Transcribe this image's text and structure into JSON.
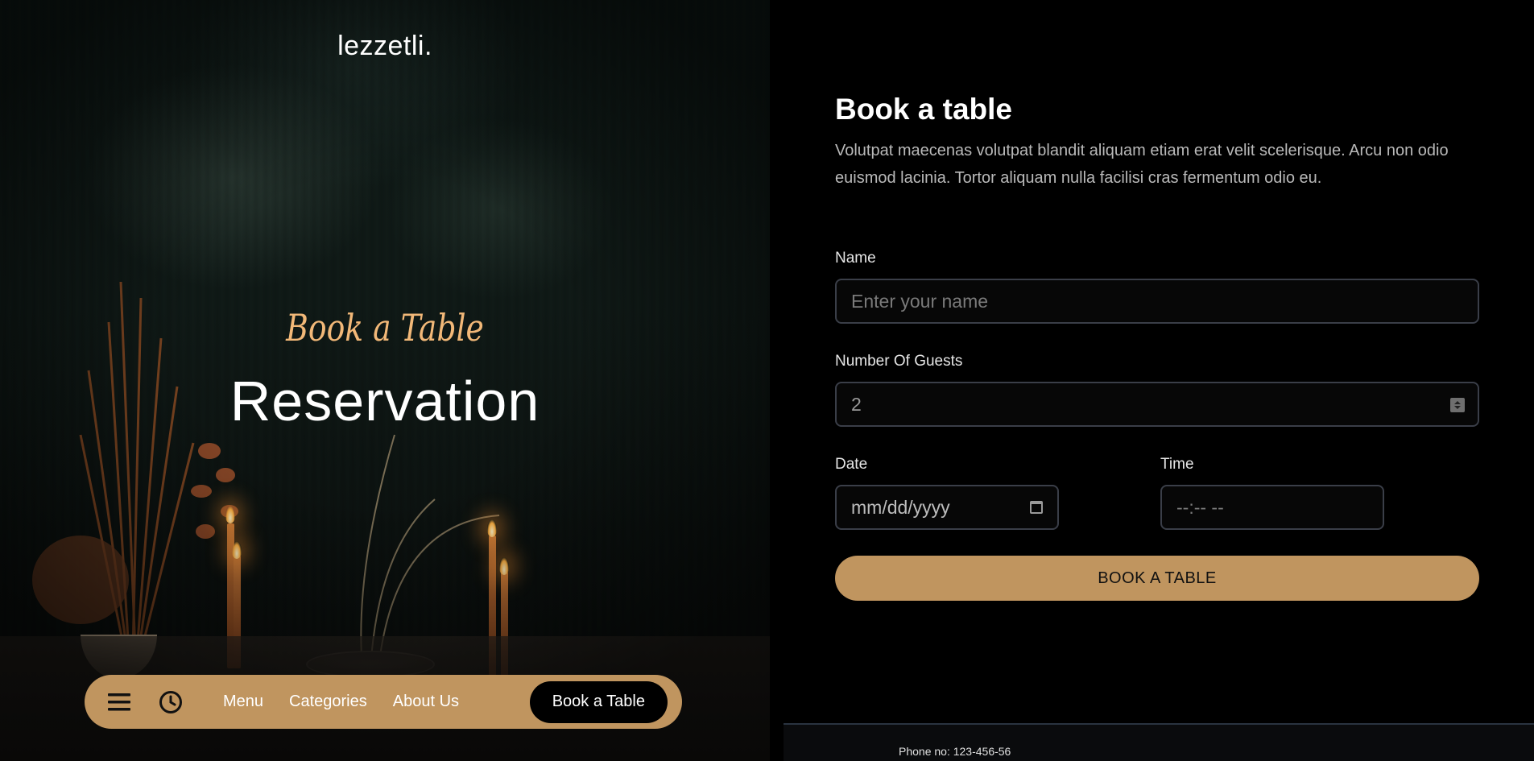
{
  "brand": {
    "name": "lezzetli."
  },
  "hero": {
    "script_title": "Book a Table",
    "title": "Reservation"
  },
  "nav": {
    "menu_icon": "hamburger-icon",
    "clock_icon": "clock-icon",
    "links": [
      "Menu",
      "Categories",
      "About Us"
    ],
    "cta": "Book a Table",
    "color": "#c0955f"
  },
  "form": {
    "title": "Book a table",
    "description": "Volutpat maecenas volutpat blandit aliquam etiam erat velit scelerisque. Arcu non odio euismod lacinia. Tortor aliquam nulla facilisi cras fermentum odio eu.",
    "name": {
      "label": "Name",
      "placeholder": "Enter your name"
    },
    "guests": {
      "label": "Number Of Guests",
      "value": "2"
    },
    "date": {
      "label": "Date",
      "placeholder": "mm/dd/yyyy"
    },
    "time": {
      "label": "Time",
      "placeholder": "--:-- --"
    },
    "submit": "BOOK A TABLE"
  },
  "footer": {
    "phone": "Phone no: 123-456-56"
  },
  "colors": {
    "accent": "#c0955f",
    "script": "#f2b878",
    "background": "#000000"
  }
}
